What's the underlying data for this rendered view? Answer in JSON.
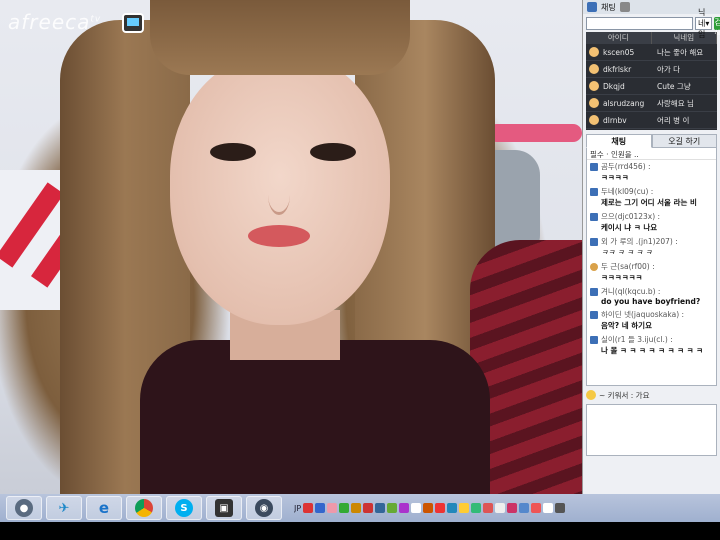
{
  "stream": {
    "watermark": "afreeca",
    "watermark_suffix": "tv"
  },
  "panel": {
    "top_label": "채팅",
    "search": {
      "placeholder": "",
      "value": "",
      "select_value": "닉네임",
      "button_label": "검색"
    },
    "user_list": {
      "headers": [
        "아이디",
        "닉네임"
      ],
      "rows": [
        {
          "id": "kscen05",
          "nick": "나는 좋아 해요"
        },
        {
          "id": "dkfrlskr",
          "nick": "아가 다"
        },
        {
          "id": "Dkqjd",
          "nick": "Cute 그냥"
        },
        {
          "id": "alsrudzang",
          "nick": "사랑해요 님"
        },
        {
          "id": "dlrnbv",
          "nick": "어리 병 이"
        }
      ]
    },
    "tabs": [
      "채팅",
      "오길 하기"
    ],
    "chat_filter": "필수 · 인원을 ..",
    "messages": [
      {
        "who": "곰두(rrd456) :",
        "text": "ㅋㅋㅋㅋ"
      },
      {
        "who": "두네(kl09(cu) :",
        "text": "제로는 그기 어디 서울 라는 비"
      },
      {
        "who": "으으(djc0123x) :",
        "text": "케이시 냐 ㅋ 나요"
      },
      {
        "who": "외 가 루의 .(jn1)207) :",
        "text": "ㅋㅋ ㅋ ㅋ ㅋ ㅋ"
      },
      {
        "who": "두 근(sa(rf00) :",
        "text": "ㅋㅋㅋㅋㅋㅋ"
      },
      {
        "who": "겨니(ql(kqcu.b) :",
        "text": "do you have boyfriend?"
      },
      {
        "who": "하이딘 넷(jaquoskaka) :",
        "text": "음악? 네 하기요"
      },
      {
        "who": "실이(r1 들 3.iju(cl.) :",
        "text": "나 몰 ㅋ ㅋ ㅋ ㅋ ㅋ ㅋ ㅋ ㅋ ㅋ"
      }
    ],
    "status": "~ 키워서 : 가요"
  },
  "taskbar": {
    "buttons": [
      "user-icon",
      "bird-icon",
      "ie-icon",
      "chrome-icon",
      "skype-icon",
      "tv-icon",
      "webcam-icon"
    ],
    "tray_lang": "JP"
  }
}
